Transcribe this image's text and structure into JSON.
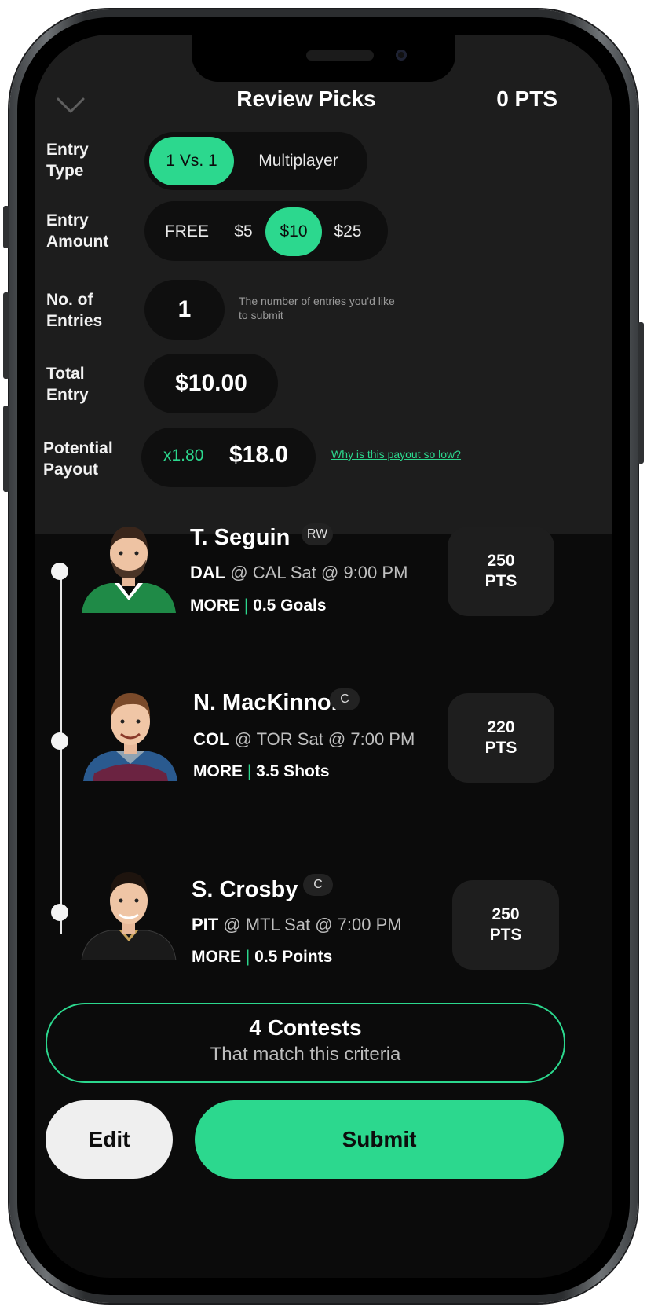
{
  "header": {
    "title": "Review Picks",
    "points": "0 PTS"
  },
  "form": {
    "entry_type": {
      "label": "Entry\nType",
      "options": [
        "1 Vs. 1",
        "Multiplayer"
      ],
      "selected": "1 Vs. 1"
    },
    "entry_amount": {
      "label": "Entry\nAmount",
      "options": [
        "FREE",
        "$5",
        "$10",
        "$25"
      ],
      "selected": "$10"
    },
    "entries": {
      "label": "No. of\nEntries",
      "value": "1",
      "hint": "The number of entries you'd like to submit"
    },
    "total_entry": {
      "label": "Total\nEntry",
      "value": "$10.00"
    },
    "potential_payout": {
      "label": "Potential\nPayout",
      "multiplier": "x1.80",
      "value": "$18.0",
      "link": "Why is this payout so low?"
    }
  },
  "picks": [
    {
      "name": "T. Seguin",
      "position": "RW",
      "team": "DAL",
      "game": "@ CAL Sat @ 9:00 PM",
      "direction": "MORE",
      "line": "0.5 Goals",
      "pts_value": "250",
      "pts_unit": "PTS",
      "jersey_color": "#1f8a47"
    },
    {
      "name": "N. MacKinnon",
      "position": "C",
      "team": "COL",
      "game": "@ TOR Sat @ 7:00 PM",
      "direction": "MORE",
      "line": "3.5 Shots",
      "pts_value": "220",
      "pts_unit": "PTS",
      "jersey_color": "#6b2341"
    },
    {
      "name": "S. Crosby",
      "position": "C",
      "team": "PIT",
      "game": "@ MTL Sat @ 7:00 PM",
      "direction": "MORE",
      "line": "0.5 Points",
      "pts_value": "250",
      "pts_unit": "PTS",
      "jersey_color": "#1a1a1a"
    }
  ],
  "contests": {
    "title": "4 Contests",
    "subtitle": "That match this criteria"
  },
  "actions": {
    "edit": "Edit",
    "submit": "Submit"
  },
  "colors": {
    "accent": "#2cd88e",
    "panel": "#1d1d1d",
    "background": "#0b0b0b"
  }
}
